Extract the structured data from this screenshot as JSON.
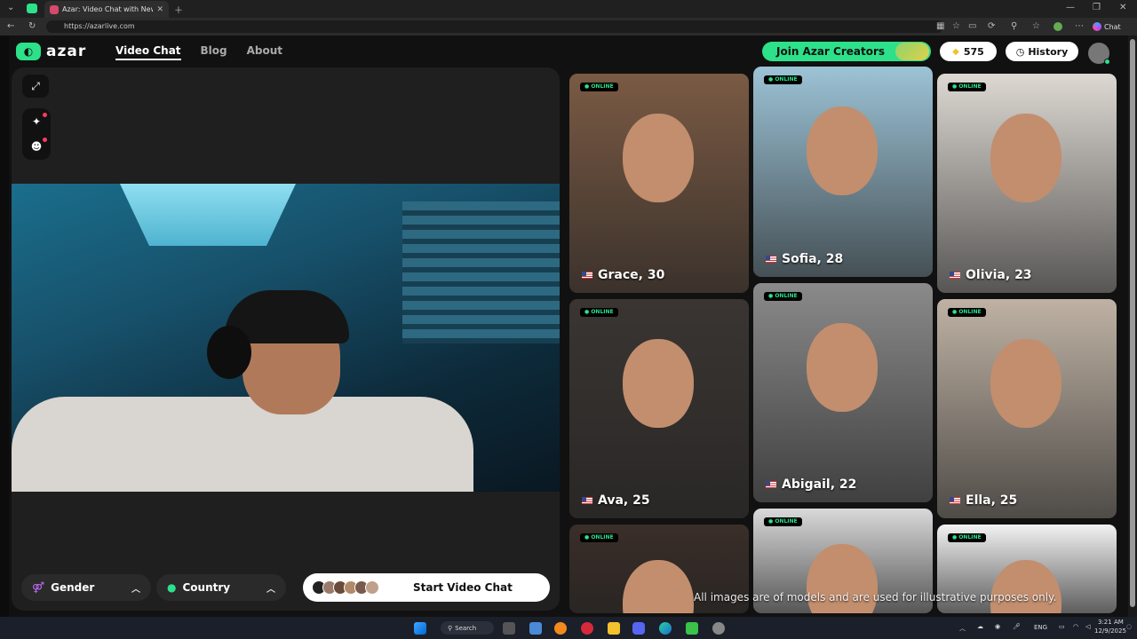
{
  "browser": {
    "tab_title": "Azar: Video Chat with New F…",
    "url": "https://azarlive.com",
    "chat_label": "Chat"
  },
  "header": {
    "logo_text": "azar",
    "nav": [
      "Video Chat",
      "Blog",
      "About"
    ],
    "join_label": "Join Azar Creators",
    "gems": "575",
    "history_label": "History"
  },
  "filters": {
    "gender_label": "Gender",
    "country_label": "Country"
  },
  "start_label": "Start Video Chat",
  "online_badge": "● ONLINE",
  "profiles": [
    {
      "name": "Grace, 30",
      "bg": "#7a5a44"
    },
    {
      "name": "Sofia, 28",
      "bg": "#9cc3d6"
    },
    {
      "name": "Olivia, 23",
      "bg": "#ddd8d2"
    },
    {
      "name": "Ava, 25",
      "bg": "#3a3532"
    },
    {
      "name": "Abigail, 22",
      "bg": "#8a8a8a"
    },
    {
      "name": "Ella, 25",
      "bg": "#bfb2a4"
    },
    {
      "name": "",
      "bg": "#3a2e28"
    },
    {
      "name": "",
      "bg": "#d9d9d9"
    },
    {
      "name": "",
      "bg": "#f2f2f2"
    }
  ],
  "disclaimer": "All images are of models and are used for illustrative purposes only.",
  "taskbar": {
    "search_label": "Search",
    "lang": "ENG",
    "time": "3:21 AM",
    "date": "12/9/2025"
  },
  "colors": {
    "accent": "#2de08a",
    "online": "#2de08a"
  }
}
